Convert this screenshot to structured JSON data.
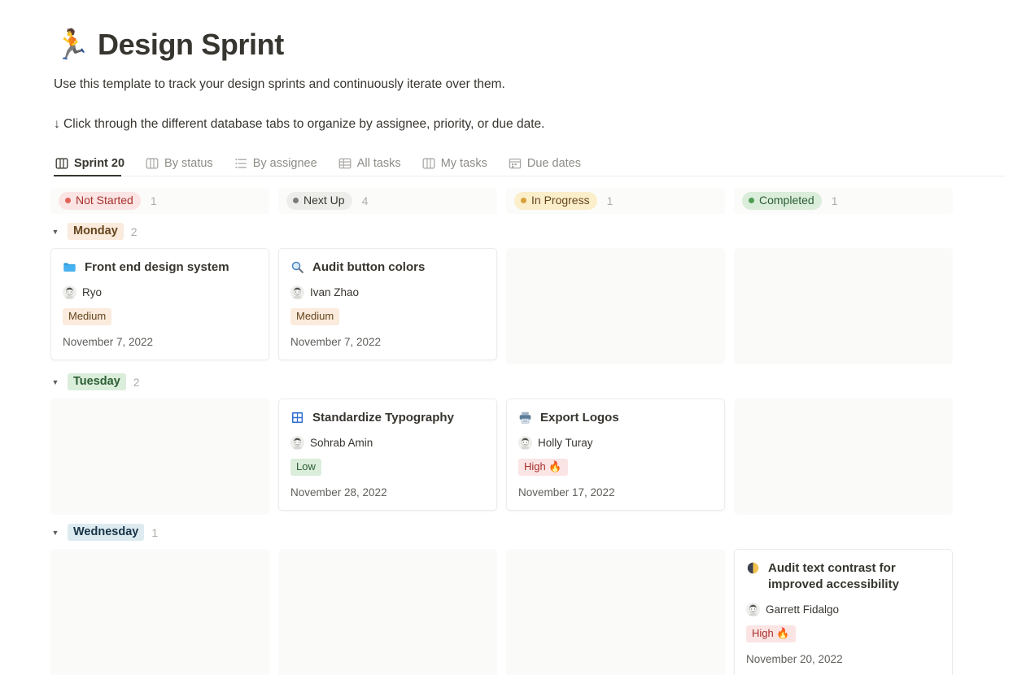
{
  "header": {
    "emoji": "🏃",
    "title": "Design Sprint",
    "subtitle": "Use this template to track your design sprints and continuously iterate over them.",
    "hint": "↓ Click through the different database tabs to organize by assignee, priority, or due date."
  },
  "tabs": [
    {
      "label": "Sprint 20",
      "icon": "board-icon",
      "active": true
    },
    {
      "label": "By status",
      "icon": "board-icon",
      "active": false
    },
    {
      "label": "By assignee",
      "icon": "list-icon",
      "active": false
    },
    {
      "label": "All tasks",
      "icon": "table-icon",
      "active": false
    },
    {
      "label": "My tasks",
      "icon": "board-icon",
      "active": false
    },
    {
      "label": "Due dates",
      "icon": "calendar-icon",
      "active": false
    }
  ],
  "statuses": [
    {
      "label": "Not Started",
      "count": "1",
      "bg": "#fbe4e4",
      "fg": "#a8312c",
      "dot": "#e16259"
    },
    {
      "label": "Next Up",
      "count": "4",
      "bg": "#ededeb",
      "fg": "#37352f",
      "dot": "#7c7c79"
    },
    {
      "label": "In Progress",
      "count": "1",
      "bg": "#fbeeca",
      "fg": "#65451d",
      "dot": "#d9a13b"
    },
    {
      "label": "Completed",
      "count": "1",
      "bg": "#dbeddb",
      "fg": "#2b5e33",
      "dot": "#4f9d55"
    }
  ],
  "groups": [
    {
      "label": "Monday",
      "count": "2",
      "label_bg": "#faebdd",
      "label_fg": "#65451d",
      "cells": [
        {
          "empty": false,
          "icon": "folder-icon",
          "title": "Front end design system",
          "assignee": "Ryo",
          "avatar": "avatar-ryo",
          "priority": "Medium",
          "priority_bg": "#faebdd",
          "priority_fg": "#65451d",
          "date": "November 7, 2022"
        },
        {
          "empty": false,
          "icon": "magnifier-icon",
          "title": "Audit button colors",
          "assignee": "Ivan Zhao",
          "avatar": "avatar-ivan",
          "priority": "Medium",
          "priority_bg": "#faebdd",
          "priority_fg": "#65451d",
          "date": "November 7, 2022"
        },
        {
          "empty": true
        },
        {
          "empty": true
        }
      ]
    },
    {
      "label": "Tuesday",
      "count": "2",
      "label_bg": "#dbeddb",
      "label_fg": "#2b5e33",
      "cells": [
        {
          "empty": true
        },
        {
          "empty": false,
          "icon": "abcd-icon",
          "title": "Standardize Typography",
          "assignee": "Sohrab Amin",
          "avatar": "avatar-sohrab",
          "priority": "Low",
          "priority_bg": "#dbeddb",
          "priority_fg": "#2b5e33",
          "date": "November 28, 2022"
        },
        {
          "empty": false,
          "icon": "printer-icon",
          "title": "Export Logos",
          "assignee": "Holly Turay",
          "avatar": "avatar-holly",
          "priority": "High 🔥",
          "priority_bg": "#fbe4e4",
          "priority_fg": "#a8312c",
          "date": "November 17, 2022"
        },
        {
          "empty": true
        }
      ]
    },
    {
      "label": "Wednesday",
      "count": "1",
      "label_bg": "#ddebf1",
      "label_fg": "#183347",
      "cells": [
        {
          "empty": true
        },
        {
          "empty": true
        },
        {
          "empty": true
        },
        {
          "empty": false,
          "icon": "contrast-icon",
          "title": "Audit text contrast for improved accessibility",
          "assignee": "Garrett Fidalgo",
          "avatar": "avatar-garrett",
          "priority": "High 🔥",
          "priority_bg": "#fbe4e4",
          "priority_fg": "#a8312c",
          "date": "November 20, 2022"
        }
      ]
    }
  ]
}
